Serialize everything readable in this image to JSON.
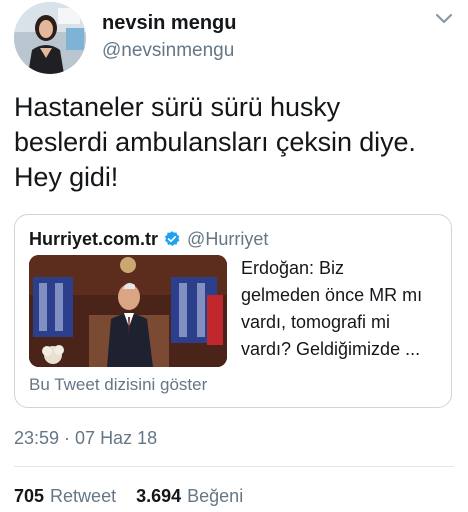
{
  "author": {
    "name": "nevsin mengu",
    "handle": "@nevsinmengu",
    "avatar_icon": "profile-photo"
  },
  "tweet": {
    "lines": [
      "Hastaneler sürü sürü husky",
      "beslerdi ambulansları çeksin diye.",
      "Hey gidi!"
    ],
    "timestamp": "23:59 · 07 Haz 18"
  },
  "quoted": {
    "name": "Hurriyet.com.tr",
    "handle": "@Hurriyet",
    "verified_color": "#1da1f2",
    "text_lines": [
      "Erdoğan: Biz",
      "gelmeden önce MR mı",
      "vardı, tomografi mi",
      "vardı? Geldiğimizde ..."
    ],
    "thread_link": "Bu Tweet dizisini göster"
  },
  "stats": {
    "retweets_count": "705",
    "retweets_label": "Retweet",
    "likes_count": "3.694",
    "likes_label": "Beğeni"
  },
  "colors": {
    "text": "#14171a",
    "secondary": "#657786",
    "border": "#ccd6dd"
  }
}
